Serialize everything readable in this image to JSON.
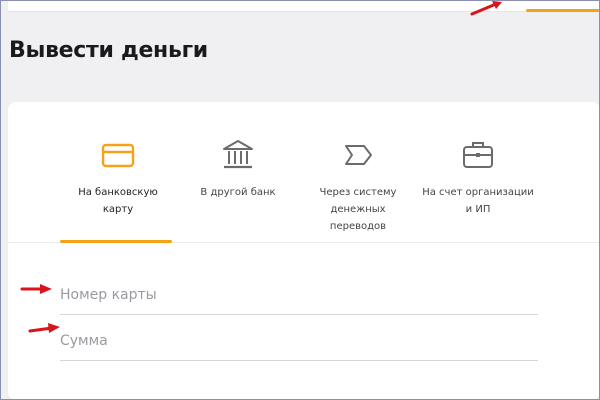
{
  "page": {
    "title": "Вывести деньги"
  },
  "tabs": [
    {
      "label": "На банковскую карту",
      "icon": "credit-card-icon",
      "active": true
    },
    {
      "label": "В другой банк",
      "icon": "bank-icon",
      "active": false
    },
    {
      "label": "Через систему денежных переводов",
      "icon": "send-arrow-icon",
      "active": false
    },
    {
      "label": "На счет организации и ИП",
      "icon": "briefcase-icon",
      "active": false
    }
  ],
  "form": {
    "card_number_placeholder": "Номер карты",
    "amount_placeholder": "Сумма"
  },
  "colors": {
    "accent": "#f5a219",
    "icon_gray": "#6b6b6b",
    "annotation_red": "#d9141a",
    "page_bg": "#f0f0f3"
  }
}
